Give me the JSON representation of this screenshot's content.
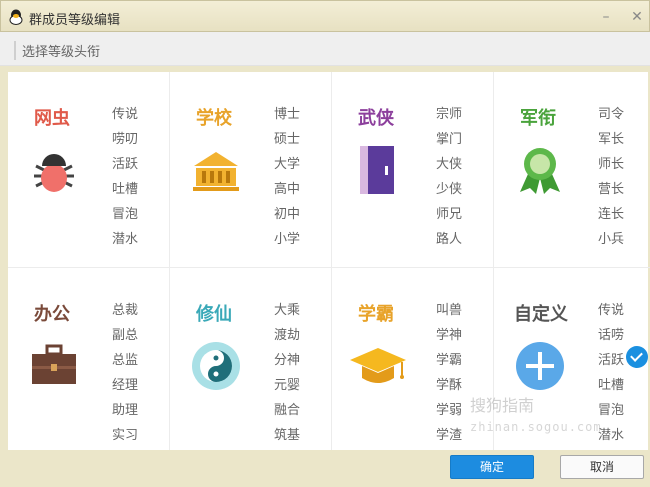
{
  "window": {
    "title": "群成员等级编辑"
  },
  "subheader": {
    "text": "选择等级头衔"
  },
  "categories": [
    {
      "name": "网虫",
      "color": "#e05a4a",
      "icon": "bug-icon",
      "levels": [
        "传说",
        "唠叨",
        "活跃",
        "吐槽",
        "冒泡",
        "潜水"
      ]
    },
    {
      "name": "学校",
      "color": "#e8a32a",
      "icon": "school-building-icon",
      "levels": [
        "博士",
        "硕士",
        "大学",
        "高中",
        "初中",
        "小学"
      ]
    },
    {
      "name": "武侠",
      "color": "#8c3f9c",
      "icon": "book-icon",
      "levels": [
        "宗师",
        "掌门",
        "大侠",
        "少侠",
        "师兄",
        "路人"
      ]
    },
    {
      "name": "军衔",
      "color": "#4aa33c",
      "icon": "medal-icon",
      "levels": [
        "司令",
        "军长",
        "师长",
        "营长",
        "连长",
        "小兵"
      ]
    },
    {
      "name": "办公",
      "color": "#7a4a3a",
      "icon": "briefcase-icon",
      "levels": [
        "总裁",
        "副总",
        "总监",
        "经理",
        "助理",
        "实习"
      ]
    },
    {
      "name": "修仙",
      "color": "#3aa9b8",
      "icon": "yin-yang-icon",
      "levels": [
        "大乘",
        "渡劫",
        "分神",
        "元婴",
        "融合",
        "筑基"
      ]
    },
    {
      "name": "学霸",
      "color": "#e8a32a",
      "icon": "graduation-cap-icon",
      "levels": [
        "叫兽",
        "学神",
        "学霸",
        "学酥",
        "学弱",
        "学渣"
      ]
    },
    {
      "name": "自定义",
      "color": "#555555",
      "icon": "plus-circle-icon",
      "levels": [
        "传说",
        "话唠",
        "活跃",
        "吐槽",
        "冒泡",
        "潜水"
      ]
    }
  ],
  "selected": "自定义",
  "buttons": {
    "ok": "确定",
    "cancel": "取消"
  },
  "watermark": {
    "text": "搜狗指南",
    "url": "zhinan.sogou.com"
  }
}
